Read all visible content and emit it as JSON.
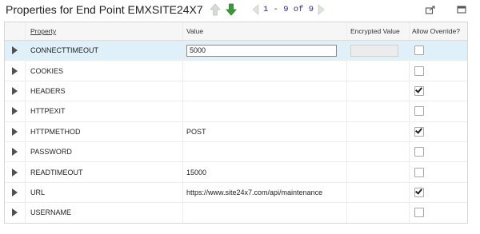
{
  "header": {
    "title": "Properties for End Point EMXSITE24X7",
    "pager_text": "1 - 9 of 9"
  },
  "colors": {
    "accent_green": "#3a9a3a",
    "selected_row": "#dff0f8"
  },
  "table": {
    "columns": [
      "Property",
      "Value",
      "Encrypted Value",
      "Allow Override?"
    ],
    "rows": [
      {
        "property": "CONNECTTIMEOUT",
        "value": "5000",
        "override": false,
        "editing": true
      },
      {
        "property": "COOKIES",
        "value": "",
        "override": false
      },
      {
        "property": "HEADERS",
        "value": "",
        "override": true
      },
      {
        "property": "HTTPEXIT",
        "value": "",
        "override": false
      },
      {
        "property": "HTTPMETHOD",
        "value": "POST",
        "override": true
      },
      {
        "property": "PASSWORD",
        "value": "",
        "override": false
      },
      {
        "property": "READTIMEOUT",
        "value": "15000",
        "override": false
      },
      {
        "property": "URL",
        "value": "https://www.site24x7.com/api/maintenance",
        "override": true
      },
      {
        "property": "USERNAME",
        "value": "",
        "override": false
      }
    ]
  }
}
